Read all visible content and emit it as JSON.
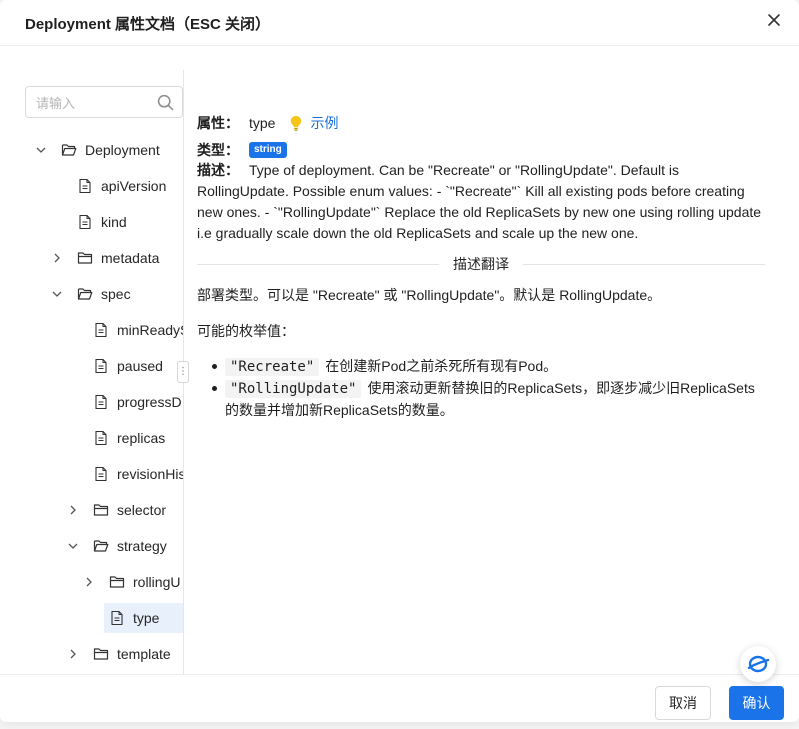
{
  "header": {
    "title": "Deployment 属性文档（ESC 关闭）"
  },
  "search": {
    "placeholder": "请输入"
  },
  "tree": [
    {
      "label": "Deployment",
      "kind": "folder",
      "expanded": true
    },
    {
      "label": "apiVersion",
      "kind": "file"
    },
    {
      "label": "kind",
      "kind": "file"
    },
    {
      "label": "metadata",
      "kind": "folder",
      "expanded": false
    },
    {
      "label": "spec",
      "kind": "folder",
      "expanded": true
    },
    {
      "label": "minReadyS",
      "kind": "file"
    },
    {
      "label": "paused",
      "kind": "file"
    },
    {
      "label": "progressD",
      "kind": "file"
    },
    {
      "label": "replicas",
      "kind": "file"
    },
    {
      "label": "revisionHis",
      "kind": "file"
    },
    {
      "label": "selector",
      "kind": "folder",
      "expanded": false
    },
    {
      "label": "strategy",
      "kind": "folder",
      "expanded": true
    },
    {
      "label": "rollingU",
      "kind": "folder",
      "expanded": false
    },
    {
      "label": "type",
      "kind": "file",
      "selected": true
    },
    {
      "label": "template",
      "kind": "folder",
      "expanded": false
    }
  ],
  "detail": {
    "prop_label": "属性：",
    "prop_value": "type",
    "example_label": "示例",
    "type_label": "类型：",
    "type_badge": "string",
    "desc_label": "描述：",
    "desc_text": "Type of deployment. Can be \"Recreate\" or \"RollingUpdate\". Default is RollingUpdate. Possible enum values: - `\"Recreate\"` Kill all existing pods before creating new ones. - `\"RollingUpdate\"` Replace the old ReplicaSets by new one using rolling update i.e gradually scale down the old ReplicaSets and scale up the new one.",
    "divider_label": "描述翻译",
    "translation": "部署类型。可以是 \"Recreate\" 或 \"RollingUpdate\"。默认是 RollingUpdate。",
    "enum_title": "可能的枚举值：",
    "enums": [
      {
        "code": "\"Recreate\"",
        "text": "在创建新Pod之前杀死所有现有Pod。"
      },
      {
        "code": "\"RollingUpdate\"",
        "text": "使用滚动更新替换旧的ReplicaSets，即逐步减少旧ReplicaSets的数量并增加新ReplicaSets的数量。"
      }
    ]
  },
  "footer": {
    "cancel_label": "取消",
    "ok_label": "确认"
  },
  "colors": {
    "primary": "#1a73e8",
    "selected_bg": "#e8f0fc",
    "bulb": "#f5c518"
  }
}
